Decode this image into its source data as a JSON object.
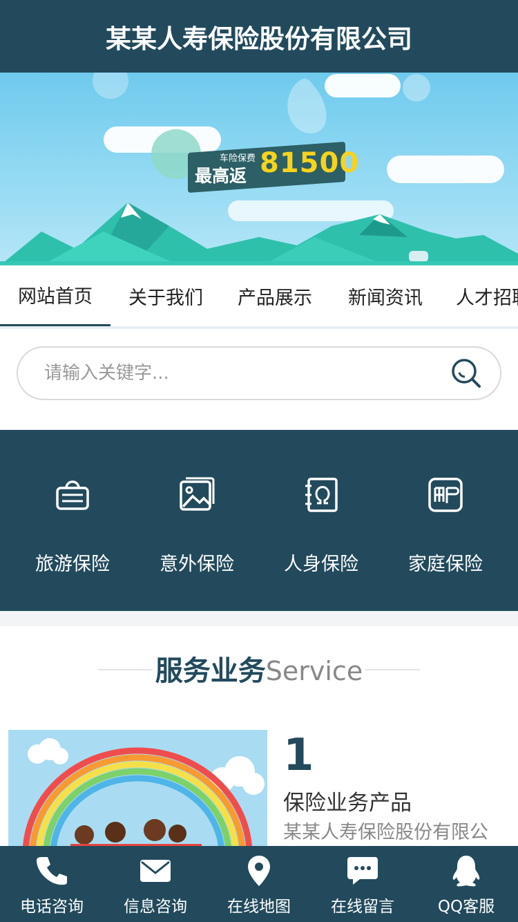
{
  "header": {
    "title": "某某人寿保险股份有限公司"
  },
  "banner": {
    "promo_small": "车险保费",
    "promo_big": "最高返",
    "promo_number": "81500"
  },
  "nav": {
    "items": [
      {
        "label": "网站首页",
        "active": true
      },
      {
        "label": "关于我们"
      },
      {
        "label": "产品展示"
      },
      {
        "label": "新闻资讯"
      },
      {
        "label": "人才招聘"
      }
    ]
  },
  "search": {
    "placeholder": "请输入关键字..."
  },
  "categories": [
    {
      "label": "旅游保险",
      "icon": "shopping-basket-icon"
    },
    {
      "label": "意外保险",
      "icon": "picture-icon"
    },
    {
      "label": "人身保险",
      "icon": "omega-icon"
    },
    {
      "label": "家庭保险",
      "icon": "mail-stamp-icon"
    }
  ],
  "section": {
    "title_cn": "服务业务",
    "title_en": "Service"
  },
  "service": {
    "number": "1",
    "title": "保险业务产品",
    "description": "某某人寿保险股份有限公"
  },
  "bottom_bar": [
    {
      "label": "电话咨询",
      "icon": "phone-icon"
    },
    {
      "label": "信息咨询",
      "icon": "envelope-icon"
    },
    {
      "label": "在线地图",
      "icon": "map-pin-icon"
    },
    {
      "label": "在线留言",
      "icon": "chat-bubble-icon"
    },
    {
      "label": "QQ客服",
      "icon": "qq-penguin-icon"
    }
  ],
  "colors": {
    "primary": "#224a5c",
    "accent": "#f7d31e",
    "banner_sky": "#6fcaed"
  }
}
